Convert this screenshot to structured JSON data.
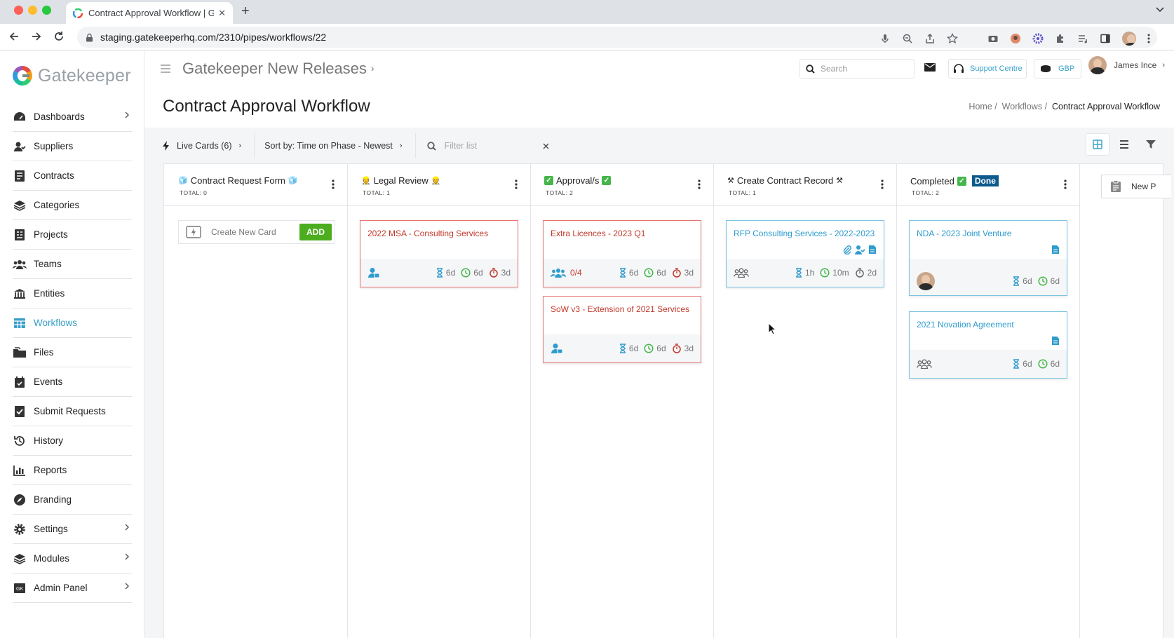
{
  "browser": {
    "tab_title": "Contract Approval Workflow | G",
    "url": "staging.gatekeeperhq.com/2310/pipes/workflows/22"
  },
  "brand": {
    "name": "Gatekeeper",
    "accent": "#3aa0c8"
  },
  "sidebar": {
    "items": [
      {
        "label": "Dashboards",
        "icon": "dashboard-icon",
        "chevron": true
      },
      {
        "label": "Suppliers",
        "icon": "suppliers-icon",
        "chevron": false
      },
      {
        "label": "Contracts",
        "icon": "contracts-icon",
        "chevron": false
      },
      {
        "label": "Categories",
        "icon": "layers-icon",
        "chevron": false
      },
      {
        "label": "Projects",
        "icon": "projects-icon",
        "chevron": false
      },
      {
        "label": "Teams",
        "icon": "teams-icon",
        "chevron": false
      },
      {
        "label": "Entities",
        "icon": "bank-icon",
        "chevron": false
      },
      {
        "label": "Workflows",
        "icon": "workflows-icon",
        "chevron": false,
        "active": true
      },
      {
        "label": "Files",
        "icon": "files-icon",
        "chevron": false
      },
      {
        "label": "Events",
        "icon": "calendar-icon",
        "chevron": false
      },
      {
        "label": "Submit Requests",
        "icon": "submit-icon",
        "chevron": false
      },
      {
        "label": "History",
        "icon": "history-icon",
        "chevron": false
      },
      {
        "label": "Reports",
        "icon": "reports-icon",
        "chevron": false
      },
      {
        "label": "Branding",
        "icon": "branding-icon",
        "chevron": false
      },
      {
        "label": "Settings",
        "icon": "gear-icon",
        "chevron": true
      },
      {
        "label": "Modules",
        "icon": "modules-icon",
        "chevron": true
      },
      {
        "label": "Admin Panel",
        "icon": "admin-icon",
        "chevron": true
      }
    ]
  },
  "header": {
    "project": "Gatekeeper New Releases",
    "search_placeholder": "Search",
    "support": "Support Centre",
    "currency": "GBP",
    "user": "James Ince",
    "page_title": "Contract Approval Workflow",
    "breadcrumb": {
      "home": "Home",
      "workflows": "Workflows",
      "current": "Contract Approval Workflow"
    }
  },
  "listbar": {
    "live_cards": "Live Cards (6)",
    "sort": "Sort by: Time on Phase - Newest",
    "filter_placeholder": "Filter list"
  },
  "board": {
    "columns": [
      {
        "title": "Contract Request Form",
        "total": "TOTAL: 0"
      },
      {
        "title": "Legal Review",
        "total": "TOTAL: 1"
      },
      {
        "title": "Approval/s",
        "total": "TOTAL: 2"
      },
      {
        "title": "Create Contract Record",
        "total": "TOTAL: 1"
      },
      {
        "title": "Completed",
        "badge": "Done",
        "total": "TOTAL: 2"
      }
    ],
    "new_card": {
      "placeholder": "Create New Card",
      "add": "ADD"
    },
    "cards": {
      "c1": {
        "title": "2022 MSA - Consulting Services",
        "m1": "6d",
        "m2": "6d",
        "m3": "3d"
      },
      "c2": {
        "title": "Extra Licences - 2023 Q1",
        "count": "0/4",
        "m1": "6d",
        "m2": "6d",
        "m3": "3d"
      },
      "c3": {
        "title": "SoW v3 - Extension of 2021 Services",
        "m1": "6d",
        "m2": "6d",
        "m3": "3d"
      },
      "c4": {
        "title": "RFP Consulting Services - 2022-2023",
        "m1": "1h",
        "m2": "10m",
        "m3": "2d"
      },
      "c5": {
        "title": "NDA - 2023 Joint Venture",
        "m1": "6d",
        "m2": "6d"
      },
      "c6": {
        "title": "2021 Novation Agreement",
        "m1": "6d",
        "m2": "6d"
      }
    },
    "new_phase": "New P"
  }
}
